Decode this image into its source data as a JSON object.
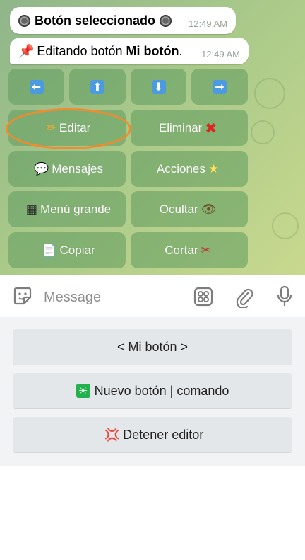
{
  "messages": [
    {
      "prefix_icon": "radio-button-icon",
      "text": "Botón seleccionado",
      "suffix_icon": "radio-button-icon",
      "time": "12:49 AM"
    },
    {
      "prefix_icon": "pushpin-icon",
      "text_plain": "Editando botón ",
      "text_bold": "Mi botón",
      "text_end": ".",
      "time": "12:49 AM"
    }
  ],
  "inline_keyboard": {
    "arrows": [
      "left-arrow-icon",
      "up-arrow-icon",
      "down-arrow-icon",
      "right-arrow-icon"
    ],
    "rows": [
      [
        {
          "icon": "pencil-icon",
          "label": "Editar"
        },
        {
          "label": "Eliminar",
          "icon_after": "cross-icon"
        }
      ],
      [
        {
          "icon": "speech-bubble-icon",
          "label": "Mensajes"
        },
        {
          "label": "Acciones",
          "icon_after": "star-icon"
        }
      ],
      [
        {
          "icon": "grid-icon",
          "label": "Menú grande"
        },
        {
          "label": "Ocultar",
          "icon_after": "eye-icon"
        }
      ],
      [
        {
          "icon": "document-icon",
          "label": "Copiar"
        },
        {
          "label": "Cortar",
          "icon_after": "scissors-icon"
        }
      ]
    ],
    "highlighted": "Editar",
    "highlight_color": "#f28a2e"
  },
  "input": {
    "placeholder": "Message"
  },
  "reply_keyboard": [
    {
      "label": "< Mi botón >"
    },
    {
      "icon": "sparkle-icon",
      "label": "Nuevo botón | comando"
    },
    {
      "icon": "anger-icon",
      "label": "Detener editor"
    }
  ],
  "colors": {
    "chat_bg": "#a9c98a",
    "button_bg": "#5f9b5f",
    "accent": "#f28a2e"
  }
}
